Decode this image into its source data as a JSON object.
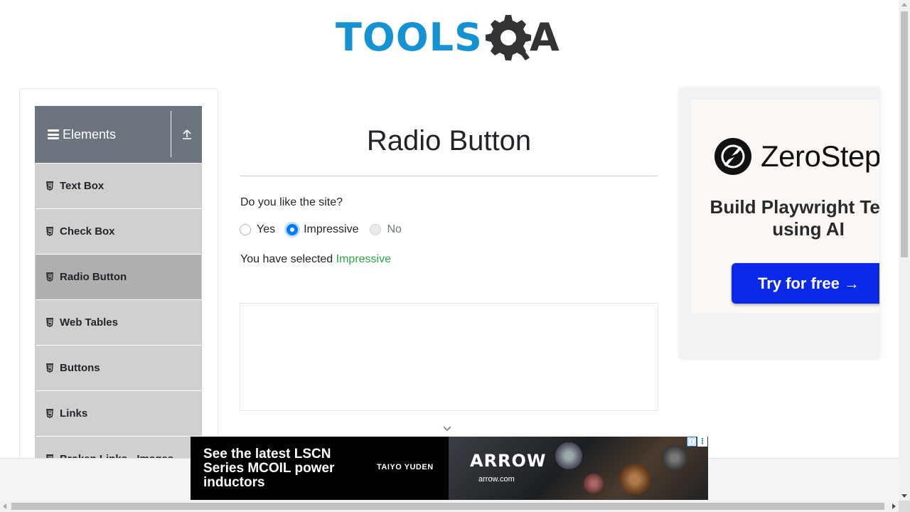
{
  "header": {
    "logo_text": "TOOLS",
    "logo_suffix": "A",
    "logo_colors": {
      "primary": "#1592d4",
      "dark": "#333333"
    }
  },
  "sidebar": {
    "group_title": "Elements",
    "items": [
      {
        "label": "Text Box",
        "active": false
      },
      {
        "label": "Check Box",
        "active": false
      },
      {
        "label": "Radio Button",
        "active": true
      },
      {
        "label": "Web Tables",
        "active": false
      },
      {
        "label": "Buttons",
        "active": false
      },
      {
        "label": "Links",
        "active": false
      },
      {
        "label": "Broken Links - Images",
        "active": false
      }
    ]
  },
  "main": {
    "title": "Radio Button",
    "question": "Do you like the site?",
    "options": [
      {
        "label": "Yes",
        "checked": false,
        "disabled": false
      },
      {
        "label": "Impressive",
        "checked": true,
        "disabled": false
      },
      {
        "label": "No",
        "checked": false,
        "disabled": true
      }
    ],
    "result_prefix": "You have selected",
    "result_value": "Impressive"
  },
  "side_ad": {
    "brand": "ZeroStep",
    "tagline": "Build Playwright Tests using AI",
    "cta": "Try for free →",
    "cta_color": "#0a28e8"
  },
  "banner_ad": {
    "headline": "See the latest LSCN Series MCOIL power inductors",
    "brand": "TAIYO YUDEN",
    "partner_logo": "ARROW",
    "partner_url": "arrow.com",
    "info_glyph": "ⓘ",
    "close_glyph": "⋮"
  },
  "colors": {
    "sidebar_header": "#6c757d",
    "menu_item": "#d0d0d0",
    "menu_item_active": "#afafaf",
    "radio_checked": "#007bff",
    "result_success": "#28a745"
  }
}
